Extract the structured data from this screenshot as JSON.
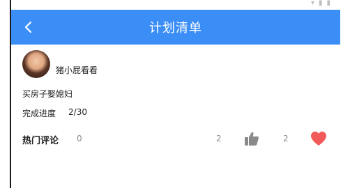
{
  "nav": {
    "title": "计划清单"
  },
  "user": {
    "name": "猪小屁看看"
  },
  "plan": {
    "name": "买房子娶媳妇",
    "progress_label": "完成进度",
    "progress_value": "2/30"
  },
  "comments": {
    "label": "热门评论",
    "count": "0",
    "likes": "2",
    "favorites": "2"
  },
  "colors": {
    "accent": "#3c8ef7",
    "heart": "#f25a5a",
    "thumb": "#8a8a8a"
  },
  "icons": {
    "back": "chevron-left-icon",
    "like": "thumbs-up-icon",
    "favorite": "heart-icon"
  }
}
